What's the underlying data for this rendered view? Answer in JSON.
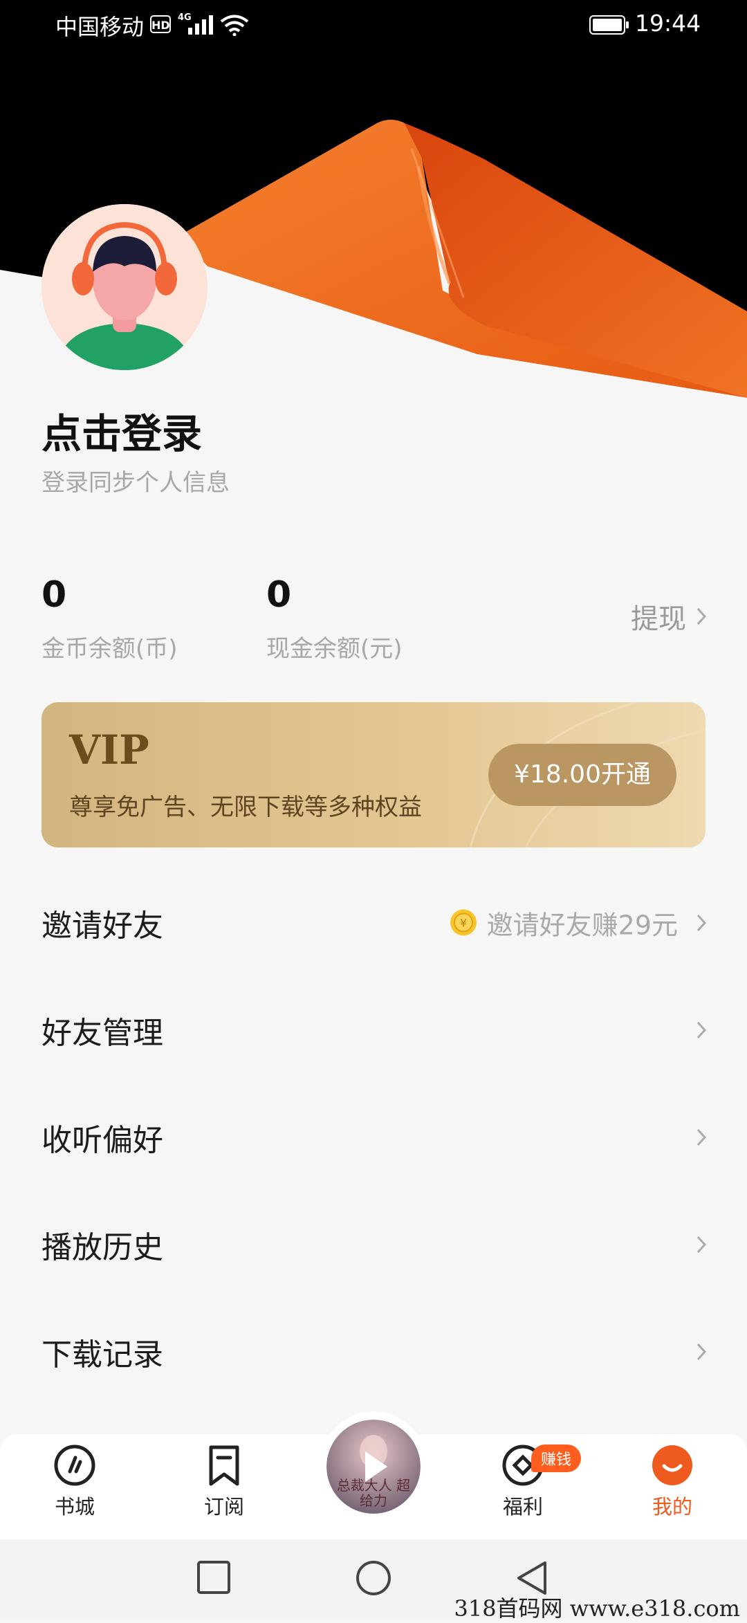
{
  "status_bar": {
    "carrier": "中国移动",
    "hd": "HD",
    "network": "4G",
    "time": "19:44"
  },
  "profile": {
    "login_title": "点击登录",
    "login_subtitle": "登录同步个人信息"
  },
  "balances": {
    "coins": {
      "value": "0",
      "label": "金币余额(币)"
    },
    "cash": {
      "value": "0",
      "label": "现金余额(元)"
    },
    "withdraw_label": "提现"
  },
  "vip": {
    "title": "VIP",
    "description": "尊享免广告、无限下载等多种权益",
    "button_label": "¥18.00开通"
  },
  "menu": [
    {
      "label": "邀请好友",
      "hint": "邀请好友赚29元"
    },
    {
      "label": "好友管理"
    },
    {
      "label": "收听偏好"
    },
    {
      "label": "播放历史"
    },
    {
      "label": "下载记录"
    }
  ],
  "bottom_nav": {
    "items": [
      {
        "label": "书城",
        "icon": "bookstore-icon"
      },
      {
        "label": "订阅",
        "icon": "bookmark-icon"
      },
      {
        "label": "福利",
        "icon": "welfare-icon"
      },
      {
        "label": "我的",
        "icon": "profile-icon"
      }
    ],
    "earn_badge": "赚钱",
    "player_cover_text": "总裁大人 超给力"
  },
  "watermark": "318首码网 www.e318.com",
  "colors": {
    "accent": "#ef5a1e",
    "vip_gold": "#d2b57f",
    "vip_button": "#b99662",
    "background": "#f6f6f6"
  }
}
